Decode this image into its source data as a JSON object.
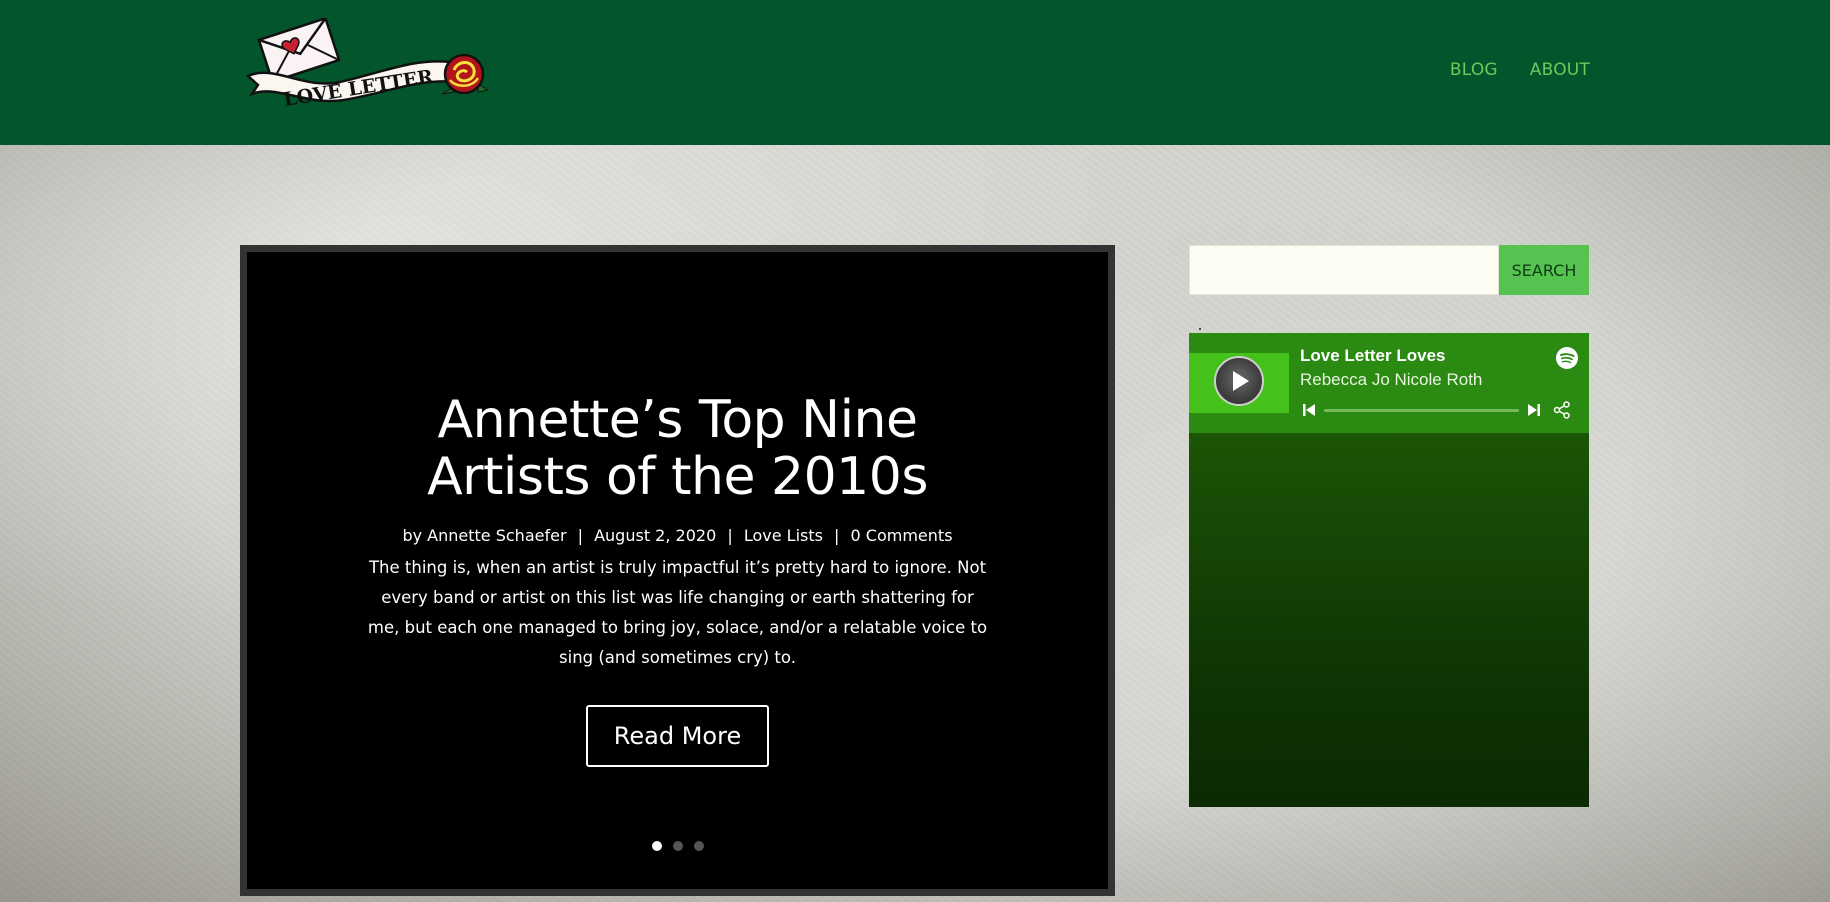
{
  "header": {
    "logo_text": "LOVE LETTER",
    "nav": [
      {
        "label": "BLOG"
      },
      {
        "label": "ABOUT"
      }
    ],
    "background": "#03552c",
    "nav_color": "#6dc95b"
  },
  "slider": {
    "title": "Annette’s Top Nine Artists of the 2010s",
    "meta": {
      "by_prefix": "by",
      "author": "Annette Schaefer",
      "separator": "|",
      "date": "August 2, 2020",
      "category": "Love Lists",
      "comments": "0 Comments"
    },
    "excerpt": "The thing is, when an artist is truly impactful it’s pretty hard to ignore. Not every band or artist on this list was life changing or earth shattering for me, but each one managed to bring joy, solace, and/or a relatable voice to sing (and sometimes cry) to.",
    "read_more": "Read More",
    "slide_count": 3,
    "active_slide": 1
  },
  "sidebar": {
    "search": {
      "placeholder": "",
      "value": "",
      "button_label": "SEARCH",
      "button_color": "#56c24f"
    },
    "spotify": {
      "playlist_title": "Love Letter Loves",
      "artist": "Rebecca Jo Nicole Roth",
      "progress": 0,
      "accent": "#44c11a",
      "icons": [
        "play-icon",
        "spotify-logo-icon",
        "previous-track-icon",
        "next-track-icon",
        "share-icon"
      ]
    }
  }
}
